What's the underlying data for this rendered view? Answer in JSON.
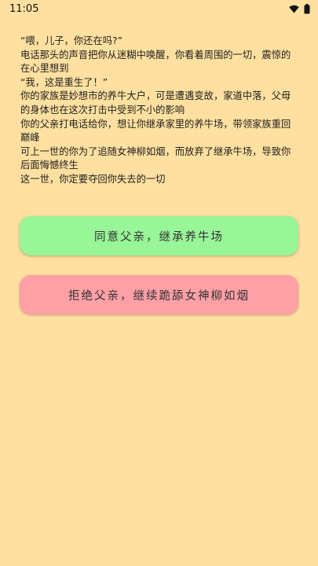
{
  "status_bar": {
    "time": "11:05",
    "icons": [
      "wifi-icon",
      "battery-icon"
    ]
  },
  "story": {
    "lines": [
      "“喂，儿子，你还在吗?”",
      "电话那头的声音把你从迷糊中唤醒，你看着周围的一切，震惊的在心里想到",
      "“我，这是重生了！”",
      "你的家族是妙想市的养牛大户，可是遭遇变故，家道中落，父母的身体也在这次打击中受到不小的影响",
      "你的父亲打电话给你，想让你继承家里的养牛场，带领家族重回巅峰",
      "可上一世的你为了追随女神柳如烟，而放弃了继承牛场，导致你后面悔憾终生",
      "这一世，你定要夺回你失去的一切"
    ]
  },
  "choices": {
    "accept_label": "同意父亲，继承养牛场",
    "reject_label": "拒绝父亲，继续跪舔女神柳如烟"
  },
  "colors": {
    "background": "#ffe0a0",
    "accept_button": "#98f598",
    "reject_button": "#ffa0a6"
  }
}
